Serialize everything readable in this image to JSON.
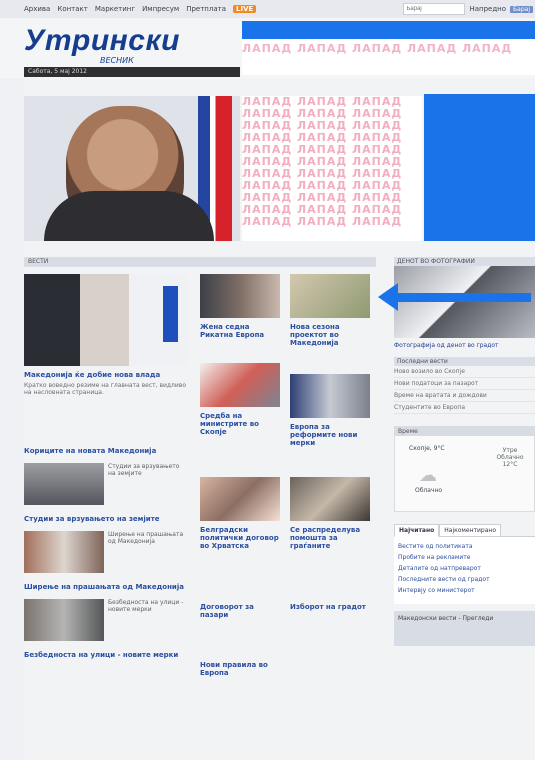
{
  "window": {
    "title": "Утрински весник"
  },
  "topbar": {
    "nav": [
      "Архива",
      "Контакт",
      "Маркетинг",
      "Импресум",
      "Претплата"
    ],
    "live": "LIVE",
    "search_placeholder": "Барај",
    "right_labels": [
      "Напредно",
      "Барај"
    ]
  },
  "brand": {
    "logo": "Утрински",
    "subtitle": "ВЕСНИК",
    "date": "Сабота, 5 мај 2012"
  },
  "ads": {
    "top_pattern": "ЛАПАД ЛАПАД ЛАПАД ЛАПАД ЛАПАД",
    "block_lines": [
      "ЛАПАД ЛАПАД ЛАПАД",
      "ЛАПАД ЛАПАД ЛАПАД",
      "ЛАПАД ЛАПАД ЛАПАД",
      "ЛАПАД ЛАПАД ЛАПАД",
      "ЛАПАД ЛАПАД ЛАПАД",
      "ЛАПАД ЛАПАД ЛАПАД",
      "ЛАПАД ЛАПАД ЛАПАД",
      "ЛАПАД ЛАПАД ЛАПАД",
      "ЛАПАД ЛАПАД ЛАПАД",
      "ЛАПАД ЛАПАД ЛАПАД",
      "ЛАПАД ЛАПАД ЛАПАД"
    ],
    "accent_color": "#1a73e8"
  },
  "section": {
    "title": "ВЕСТИ"
  },
  "main_story": {
    "headline": "Македонија ќе добие нова влада",
    "text": "Кратко воведно резиме на главната вест, видливо на насловната страница."
  },
  "stories": [
    {
      "headline": "Жена седна Рикатна Европа"
    },
    {
      "headline": "Нова сезона проектот во Македонија"
    },
    {
      "headline": "Средба на министрите во Скопје"
    },
    {
      "headline": "Европа за реформите нови мерки"
    },
    {
      "headline": "Белградски политички договор во Хрватска"
    },
    {
      "headline": "Се распределува помошта за граѓаните"
    }
  ],
  "left_links": [
    "Кориците на новата Македонија",
    "Студии за врзувањето на земјите",
    "Ширење на прашањата од Македонија",
    "Безбедноста на улици - новите мерки"
  ],
  "bottom_links": [
    "Договорот за пазари",
    "Изборот на градот",
    "Нови правила во Европа"
  ],
  "sidebar": {
    "photo_title": "ДЕНОТ ВО ФОТОГРАФИИ",
    "photo_caption": "Фотографија од денот во градот",
    "popular_title": "Последни вести",
    "popular": [
      "Ново возило во Скопје",
      "Нови податоци за пазарот",
      "Време на вратата и дождови",
      "Студентите во Европа"
    ],
    "weather_title": "Време",
    "weather_city": "Скопје, 9°C",
    "weather_state": "Облачно",
    "weather_right": [
      "Утре",
      "Облачно",
      "12°C"
    ],
    "tabs": [
      "Најчитано",
      "Најкоментирано"
    ],
    "tab_links": [
      "Вестите од политиката",
      "Пробите на рекламите",
      "Деталите од натпреварот",
      "Последните вести од градот",
      "Интервју со министерот"
    ],
    "footer": "Македонски вести - Прегледи"
  }
}
